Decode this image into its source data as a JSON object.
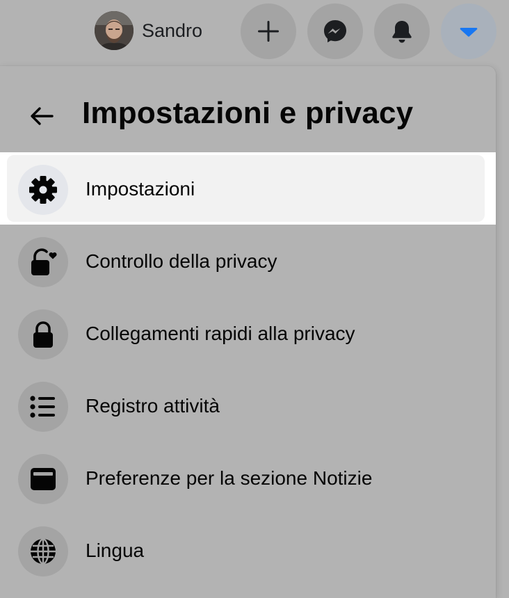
{
  "header": {
    "profile_name": "Sandro",
    "buttons": [
      {
        "name": "create",
        "icon": "plus-icon"
      },
      {
        "name": "messenger",
        "icon": "messenger-icon"
      },
      {
        "name": "notifications",
        "icon": "bell-icon"
      },
      {
        "name": "account",
        "icon": "caret-down-icon",
        "active": true
      }
    ],
    "accent_color": "#1877f2"
  },
  "panel": {
    "title": "Impostazioni e privacy",
    "items": [
      {
        "label": "Impostazioni",
        "icon": "gear-icon",
        "highlighted": true
      },
      {
        "label": "Controllo della privacy",
        "icon": "lock-heart-icon"
      },
      {
        "label": "Collegamenti rapidi alla privacy",
        "icon": "lock-icon"
      },
      {
        "label": "Registro attività",
        "icon": "list-icon"
      },
      {
        "label": "Preferenze per la sezione Notizie",
        "icon": "news-feed-icon"
      },
      {
        "label": "Lingua",
        "icon": "globe-icon"
      }
    ]
  }
}
